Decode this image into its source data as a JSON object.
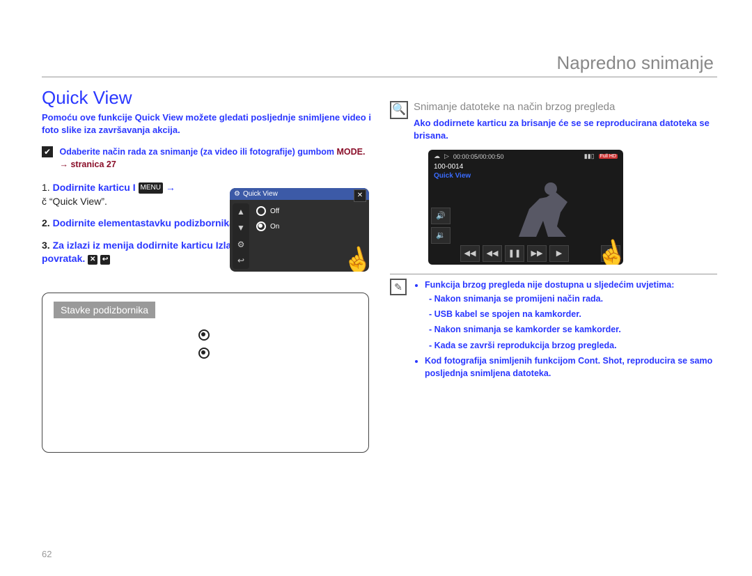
{
  "header": {
    "section": "Napredno snimanje"
  },
  "title": "Quick View",
  "intro": "Pomoću ove funkcije Quick View možete gledati posljednje snimljene video i foto slike iza završavanja akcija.",
  "checknote": {
    "line1": "Odaberite način rada za snimanje (za video ili fotografije) gumbom",
    "line2_label": "MODE.",
    "page_ref": "→ stranica 27"
  },
  "steps": [
    {
      "n": "1.",
      "pre": "Dodirnite karticu I",
      "keycap": "MENU",
      "post": "→",
      "black": "“Quick View”."
    },
    {
      "n": "2.",
      "text": "Dodirnite elementastavku podizbornika."
    },
    {
      "n": "3.",
      "text": "Za izlazi iz menija dodirnite karticu Izlazi ili povratak.",
      "icons": [
        "✕",
        "↩"
      ]
    }
  ],
  "ui_panel": {
    "title": "Quick View",
    "options": [
      "Off",
      "On"
    ],
    "leftcol_icons": [
      "▲",
      "▼",
      "⚙",
      "↩"
    ]
  },
  "subbox": {
    "label": "Stavke podizbornika",
    "rows": [
      {
        "icon_name": "radio-on"
      },
      {
        "icon_name": "radio-on"
      }
    ]
  },
  "preview": {
    "title": "Snimanje datoteke na način brzog pregleda",
    "desc": "Ako dodirnete karticu za brisanje će se se reproducirana datoteka se brisana."
  },
  "playback": {
    "time": "00:00:05/00:00:50",
    "counter": "100-0014",
    "qv_label": "Quick View",
    "fullhd": "Full HD",
    "controls": [
      "◀◀",
      "◀◀",
      "❚❚",
      "▶▶",
      "▶",
      "🗑"
    ],
    "left_buttons": [
      "🔊",
      "🔉"
    ]
  },
  "notes": {
    "lead": "Funkcija brzog pregleda nije dostupna u sljedećim uvjetima:",
    "sub": [
      "Nakon snimanja se promijeni način rada.",
      "USB kabel se spojen na kamkorder.",
      "Nakon snimanja se kamkorder se kamkorder.",
      "Kada se završi reprodukcija brzog pregleda."
    ],
    "trailing": "Kod fotografija snimljenih funkcijom Cont. Shot, reproducira se samo posljednja snimljena datoteka."
  },
  "page_number": "62"
}
